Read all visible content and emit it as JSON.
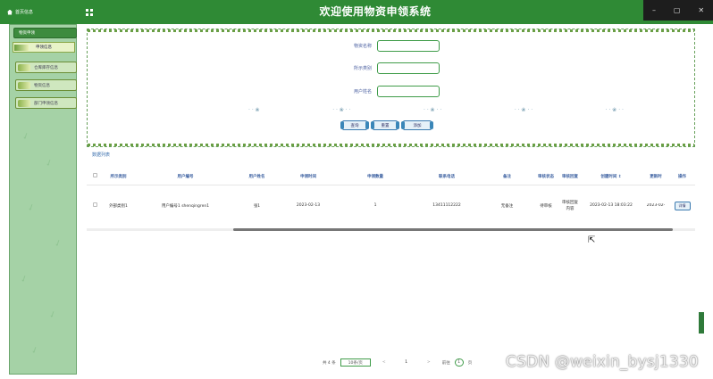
{
  "header": {
    "home_label": "首页信息",
    "title": "欢迎使用物资申领系统",
    "win_min": "–",
    "win_max": "▢",
    "win_close": "✕"
  },
  "sidebar": {
    "items": [
      {
        "label": "物资申领",
        "active": true
      },
      {
        "label": "申领信息"
      },
      {
        "label": "仓库库存信息"
      },
      {
        "label": "物资信息"
      },
      {
        "label": "部门申领信息"
      }
    ]
  },
  "search": {
    "fields": [
      {
        "label": "物资名称",
        "value": ""
      },
      {
        "label": "所示类别",
        "value": ""
      },
      {
        "label": "用户姓名",
        "value": ""
      }
    ],
    "buttons": [
      "查询",
      "重置",
      "添加"
    ]
  },
  "table": {
    "list_label": "数据列表",
    "columns": [
      "所示类别",
      "用户编号",
      "用户姓名",
      "申领时间",
      "申领数量",
      "联系电话",
      "备注",
      "审核状态",
      "审核回复",
      "创建时间 ↕",
      "更新时",
      "操作"
    ],
    "rows": [
      {
        "cells": [
          "外部类别1",
          "用户编号1 shenqingren1",
          "张1",
          "2023-02-13",
          "1",
          "13411112222",
          "无备注",
          "待审核",
          "审核回复内容",
          "2023-02-13 18:03:22",
          "2023-02-",
          ""
        ],
        "op": "详情"
      }
    ]
  },
  "pager": {
    "total": "共 4 条",
    "size": "10条/页",
    "prev": "<",
    "page": "1",
    "next": ">",
    "goto": "前往",
    "goto_value": "1",
    "unit": "页"
  },
  "watermark": "CSDN @weixin_bysj1330"
}
